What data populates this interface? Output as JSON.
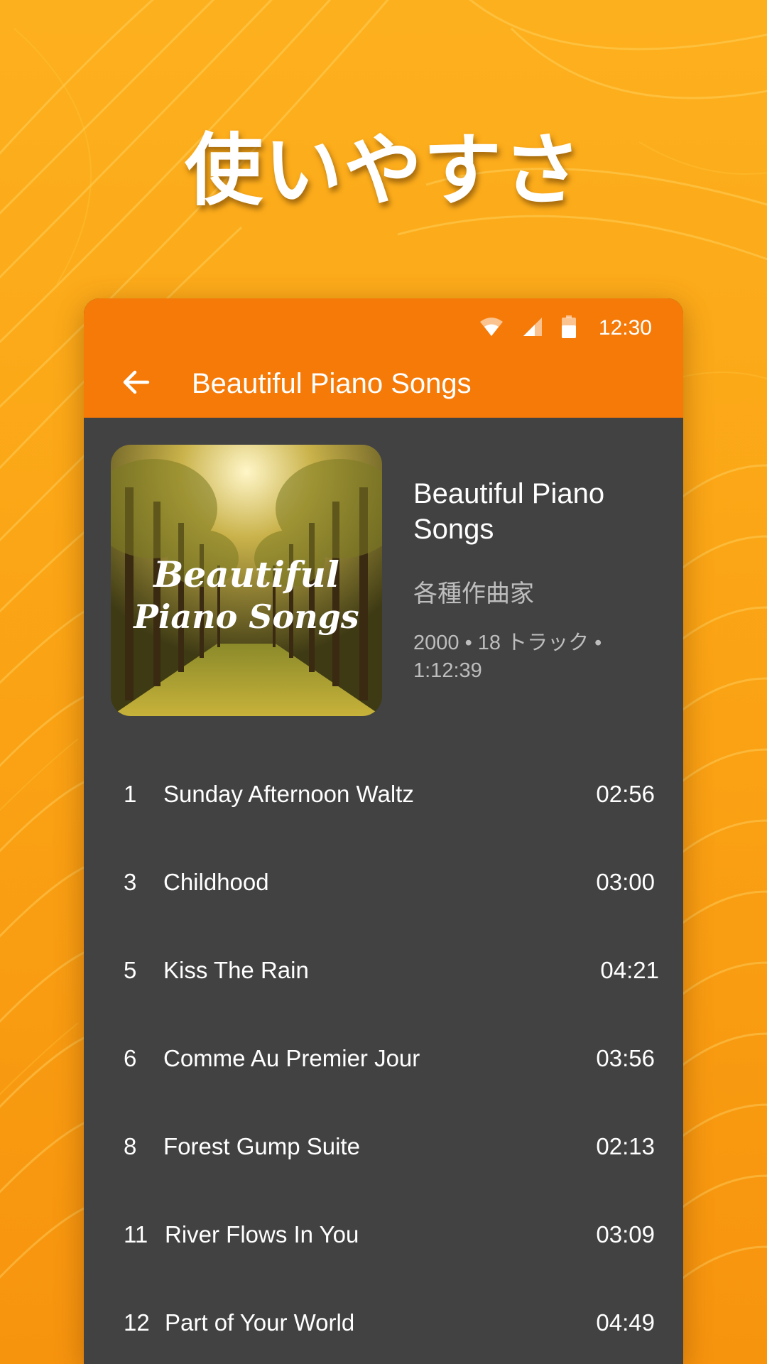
{
  "headline": "使いやすさ",
  "status_bar": {
    "time": "12:30",
    "icons": [
      "wifi-icon",
      "signal-icon",
      "battery-icon"
    ]
  },
  "toolbar": {
    "back_icon": "arrow-left-icon",
    "title": "Beautiful Piano Songs"
  },
  "album": {
    "art_text_line1": "Beautiful",
    "art_text_line2": "Piano Songs",
    "title": "Beautiful Piano Songs",
    "artist": "各種作曲家",
    "meta": "2000 • 18 トラック • 1:12:39"
  },
  "tracks": [
    {
      "number": "1",
      "title": "Sunday Afternoon Waltz",
      "duration": "02:56"
    },
    {
      "number": "3",
      "title": "Childhood",
      "duration": "03:00"
    },
    {
      "number": "5",
      "title": "Kiss The Rain",
      "duration": "04:21"
    },
    {
      "number": "6",
      "title": "Comme Au Premier Jour",
      "duration": "03:56"
    },
    {
      "number": "8",
      "title": "Forest Gump Suite",
      "duration": "02:13"
    },
    {
      "number": "11",
      "title": "River Flows In You",
      "duration": "03:09"
    },
    {
      "number": "12",
      "title": "Part of Your World",
      "duration": "04:49"
    }
  ],
  "colors": {
    "background_top": "#fdb01e",
    "background_bottom": "#f7940e",
    "appbar": "#f57a08",
    "content": "#424242",
    "secondary_text": "#bdbdbd"
  }
}
